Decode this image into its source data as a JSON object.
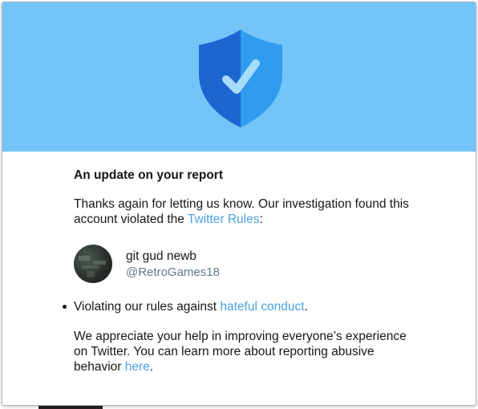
{
  "colors": {
    "hero_background": "#74c5f7",
    "shield_dark": "#1b66d1",
    "shield_light": "#2f9cf0",
    "link": "#4ba1e0",
    "text": "#14171a",
    "secondary_text": "#657786"
  },
  "hero": {
    "icon": "shield-check-icon"
  },
  "title": "An update on your report",
  "intro": {
    "text": "Thanks again for letting us know. Our investigation found this account violated the ",
    "link_label": "Twitter Rules",
    "suffix": ":"
  },
  "account": {
    "name": "git gud newb",
    "handle": "@RetroGames18"
  },
  "violations": [
    {
      "text": "Violating our rules against ",
      "link_label": "hateful conduct",
      "suffix": "."
    }
  ],
  "closing": {
    "text": "We appreciate your help in improving everyone’s experience on Twitter. You can learn more about reporting abusive behavior ",
    "link_label": "here",
    "suffix": "."
  }
}
